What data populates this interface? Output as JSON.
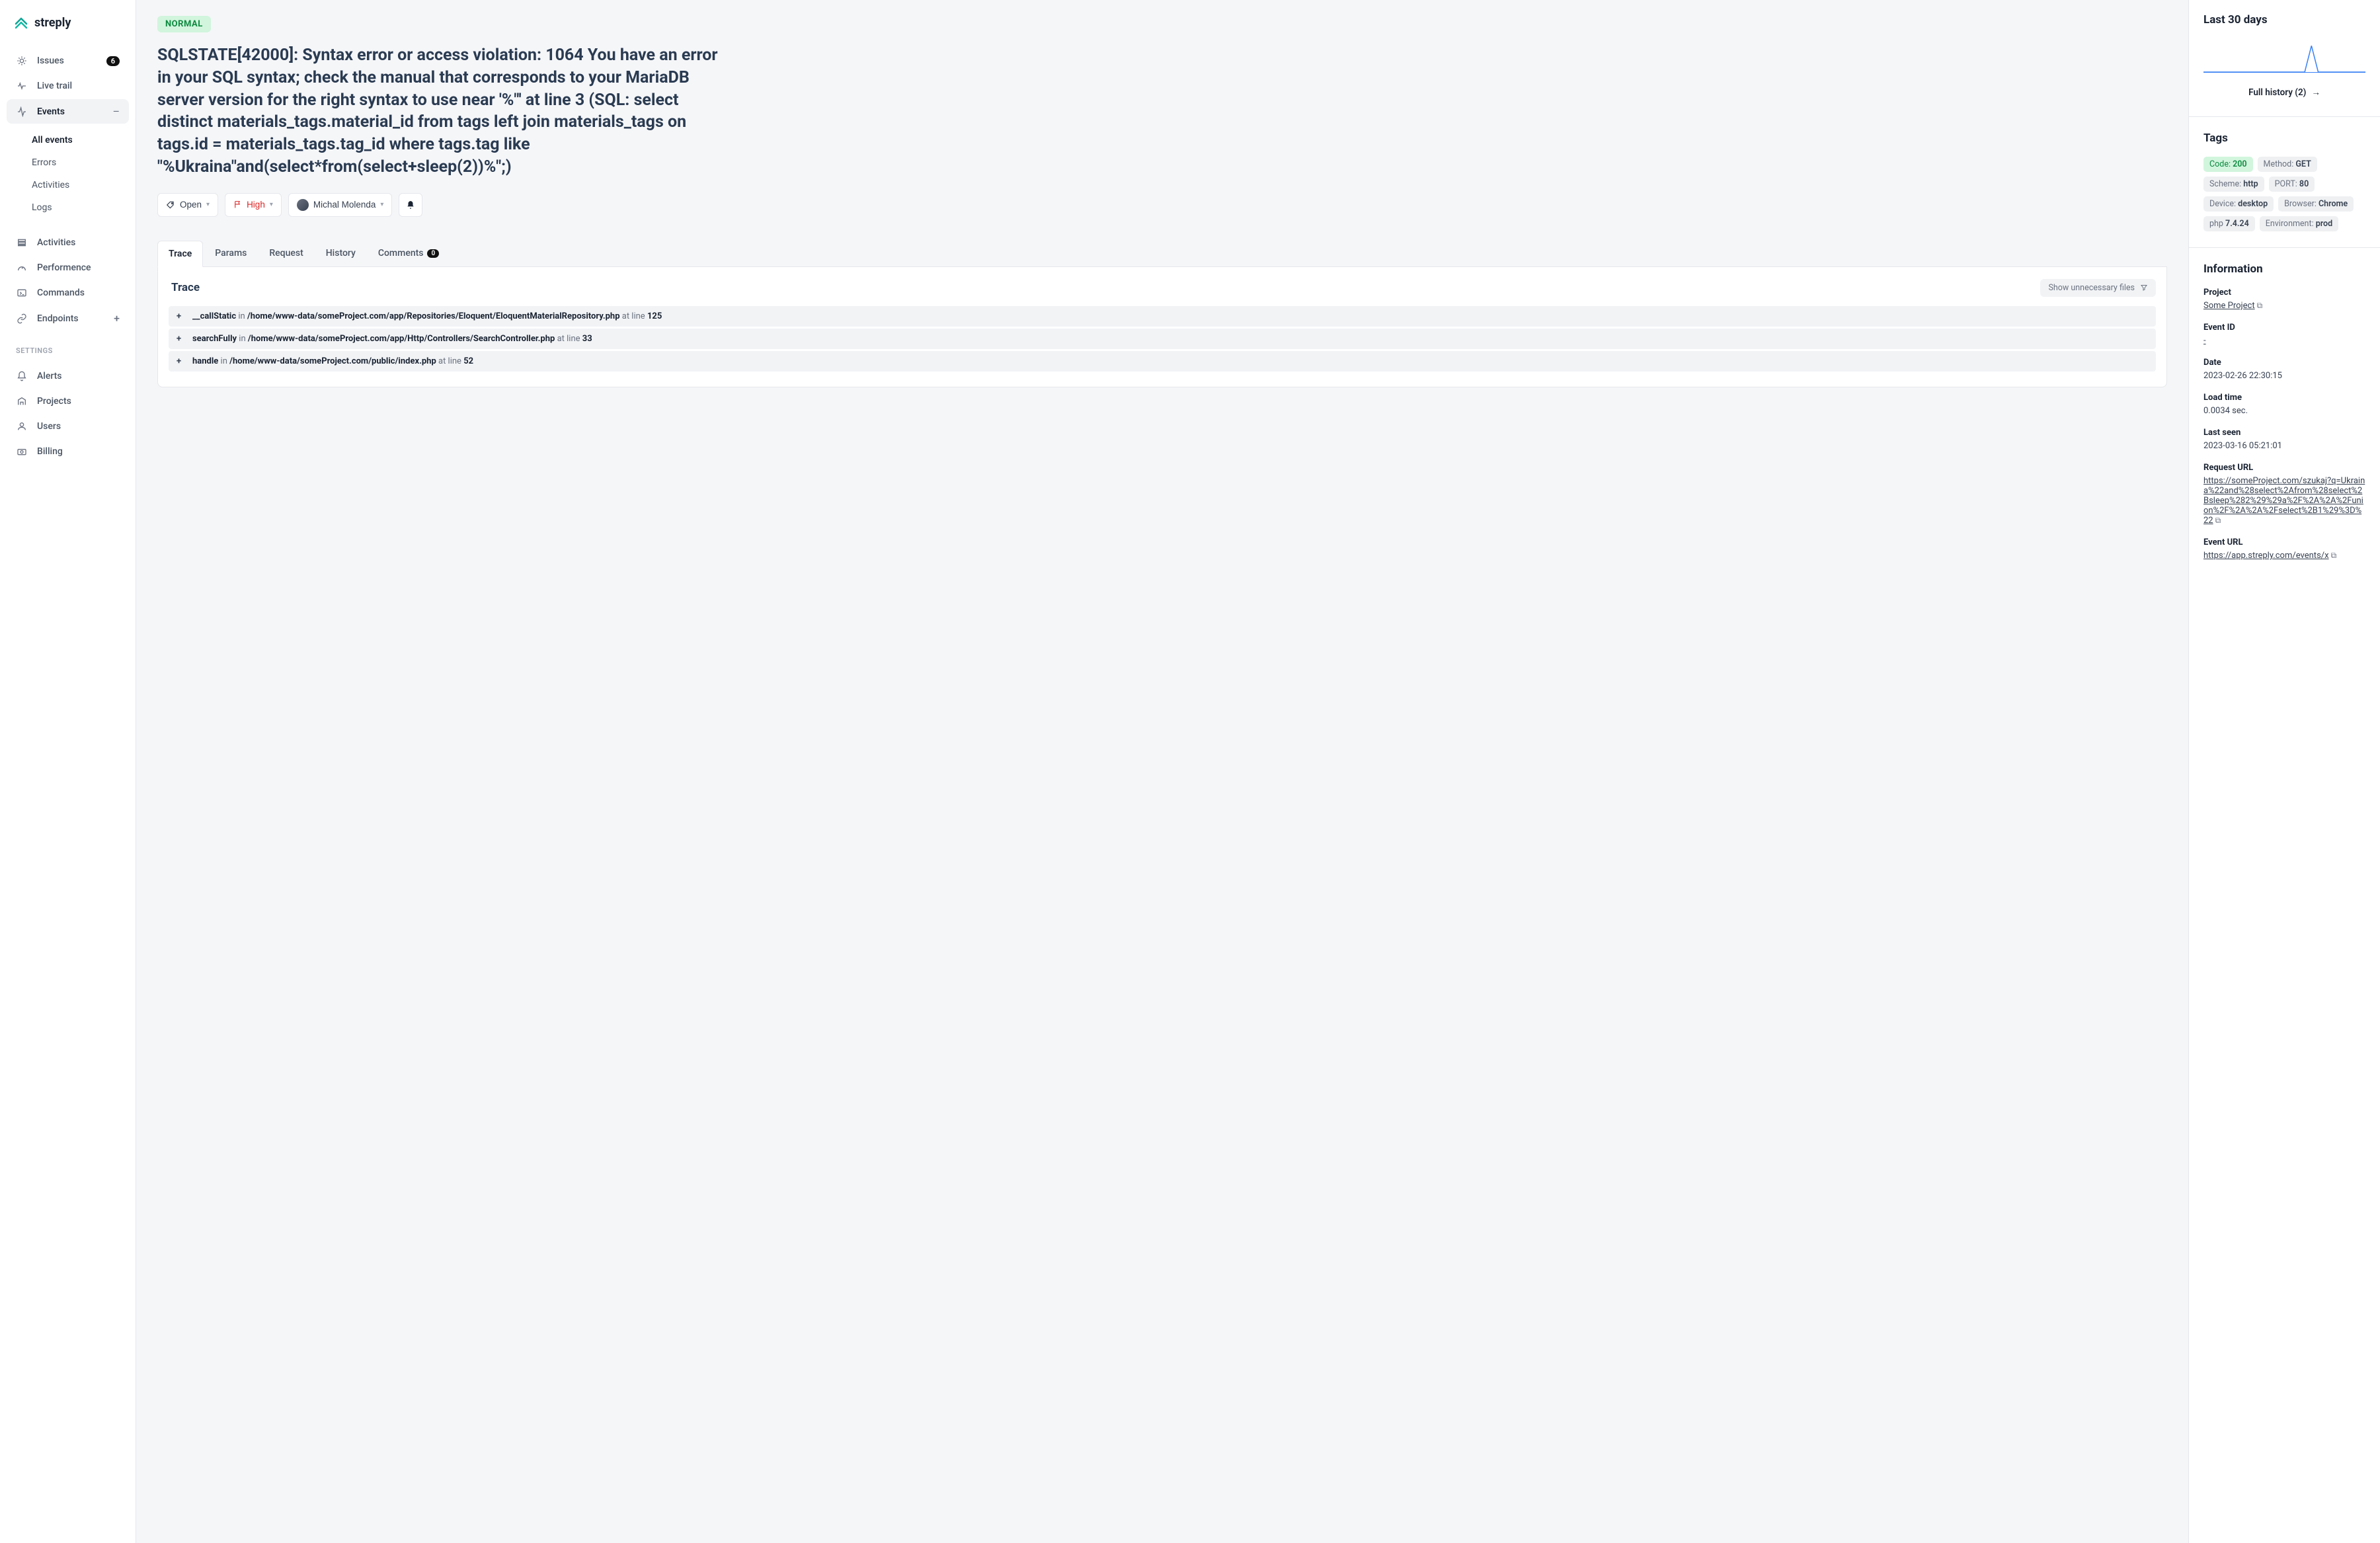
{
  "brand": "streply",
  "sidebar": {
    "issues": {
      "label": "Issues",
      "count": "6"
    },
    "live_trail": "Live trail",
    "events": "Events",
    "sub": {
      "all": "All events",
      "errors": "Errors",
      "activities": "Activities",
      "logs": "Logs"
    },
    "activities": "Activities",
    "performance": "Performence",
    "commands": "Commands",
    "endpoints": "Endpoints",
    "settings_label": "SETTINGS",
    "alerts": "Alerts",
    "projects": "Projects",
    "users": "Users",
    "billing": "Billing"
  },
  "main": {
    "badge": "NORMAL",
    "title": "SQLSTATE[42000]: Syntax error or access violation: 1064 You have an error in your SQL syntax; check the manual that corresponds to your MariaDB server version for the right syntax to use near '%\"' at line 3 (SQL: select distinct materials_tags.material_id from tags left join materials_tags on tags.id = materials_tags.tag_id where tags.tag like \"%Ukraina\"and(select*from(select+sleep(2))%\";)",
    "status": "Open",
    "priority": "High",
    "assignee": "Michal Molenda",
    "tabs": {
      "trace": "Trace",
      "params": "Params",
      "request": "Request",
      "history": "History",
      "comments": "Comments",
      "comments_count": "0"
    },
    "trace_title": "Trace",
    "filter_label": "Show unnecessary files",
    "trace": [
      {
        "fn": "__callStatic",
        "path": "/home/www-data/someProject.com/app/Repositories/Eloquent/EloquentMaterialRepository.php",
        "line": "125"
      },
      {
        "fn": "searchFully",
        "path": "/home/www-data/someProject.com/app/Http/Controllers/SearchController.php",
        "line": "33"
      },
      {
        "fn": "handle",
        "path": "/home/www-data/someProject.com/public/index.php",
        "line": "52"
      }
    ]
  },
  "right": {
    "last30": "Last 30 days",
    "history_link": "Full history (2)",
    "tags_title": "Tags",
    "tags": [
      {
        "k": "Code:",
        "v": "200",
        "green": true
      },
      {
        "k": "Method:",
        "v": "GET"
      },
      {
        "k": "Scheme:",
        "v": "http"
      },
      {
        "k": "PORT:",
        "v": "80"
      },
      {
        "k": "Device:",
        "v": "desktop"
      },
      {
        "k": "Browser:",
        "v": "Chrome"
      },
      {
        "k": "php",
        "v": "7.4.24"
      },
      {
        "k": "Environment:",
        "v": "prod"
      }
    ],
    "info_title": "Information",
    "info": {
      "project_l": "Project",
      "project_v": "Some Project",
      "eventid_l": "Event ID",
      "eventid_v": "-",
      "date_l": "Date",
      "date_v": "2023-02-26 22:30:15",
      "load_l": "Load time",
      "load_v": "0.0034 sec.",
      "last_l": "Last seen",
      "last_v": "2023-03-16 05:21:01",
      "req_l": "Request URL",
      "req_v": "https://someProject.com/szukaj?q=Ukraina%22and%28select%2Afrom%28select%2Bsleep%282%29%29a%2F%2A%2A%2Funion%2F%2A%2A%2Fselect%2B1%29%3D%22",
      "evurl_l": "Event URL",
      "evurl_v": "https://app.streply.com/events/x"
    }
  }
}
